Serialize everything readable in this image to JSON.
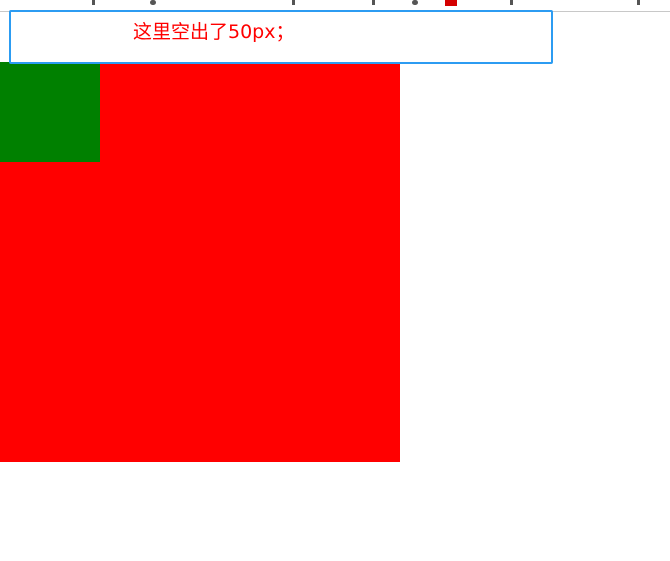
{
  "annotation": {
    "text": "这里空出了50px；"
  },
  "colors": {
    "outer_box": "#ff0000",
    "inner_box": "#008000",
    "annotation_border": "#2c9cf2",
    "annotation_text": "#ff0000"
  }
}
